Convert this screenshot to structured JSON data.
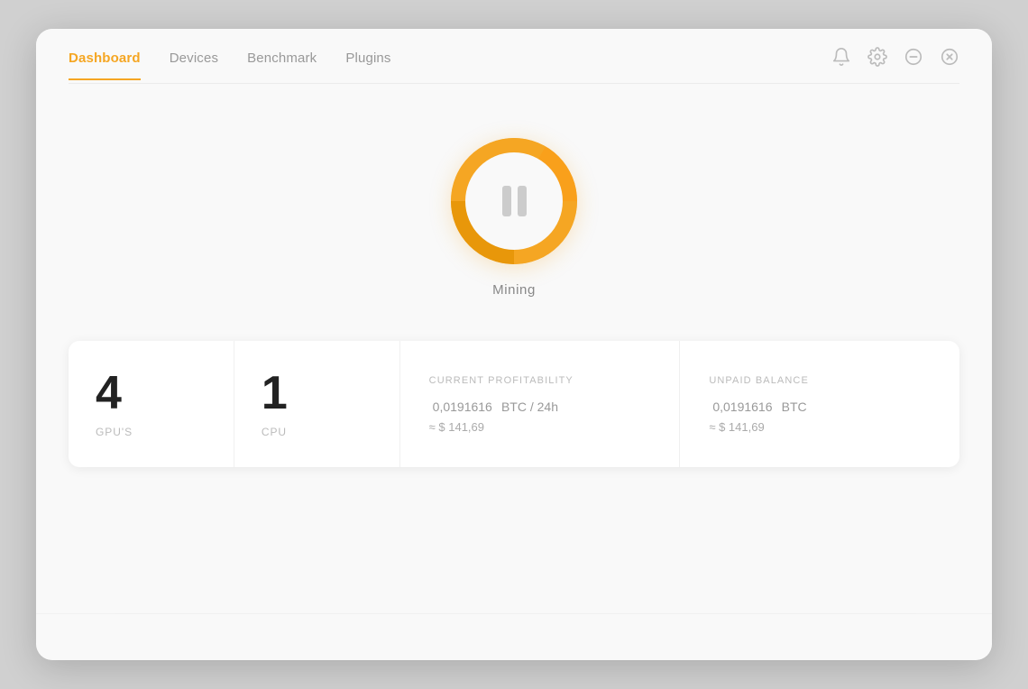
{
  "nav": {
    "tabs": [
      {
        "id": "dashboard",
        "label": "Dashboard",
        "active": true
      },
      {
        "id": "devices",
        "label": "Devices",
        "active": false
      },
      {
        "id": "benchmark",
        "label": "Benchmark",
        "active": false
      },
      {
        "id": "plugins",
        "label": "Plugins",
        "active": false
      }
    ],
    "icons": {
      "bell": "🔔",
      "gear": "⚙",
      "minimize": "⊖",
      "close": "⊗"
    }
  },
  "mining": {
    "label": "Mining",
    "status": "paused"
  },
  "stats": {
    "gpus": {
      "count": "4",
      "label": "GPU'S"
    },
    "cpu": {
      "count": "1",
      "label": "CPU"
    },
    "profitability": {
      "title": "CURRENT PROFITABILITY",
      "btc_value": "0,0191616",
      "btc_unit": "BTC / 24h",
      "usd_approx": "≈ $ 141,69"
    },
    "balance": {
      "title": "UNPAID BALANCE",
      "btc_value": "0,0191616",
      "btc_unit": "BTC",
      "usd_approx": "≈ $ 141,69"
    }
  }
}
